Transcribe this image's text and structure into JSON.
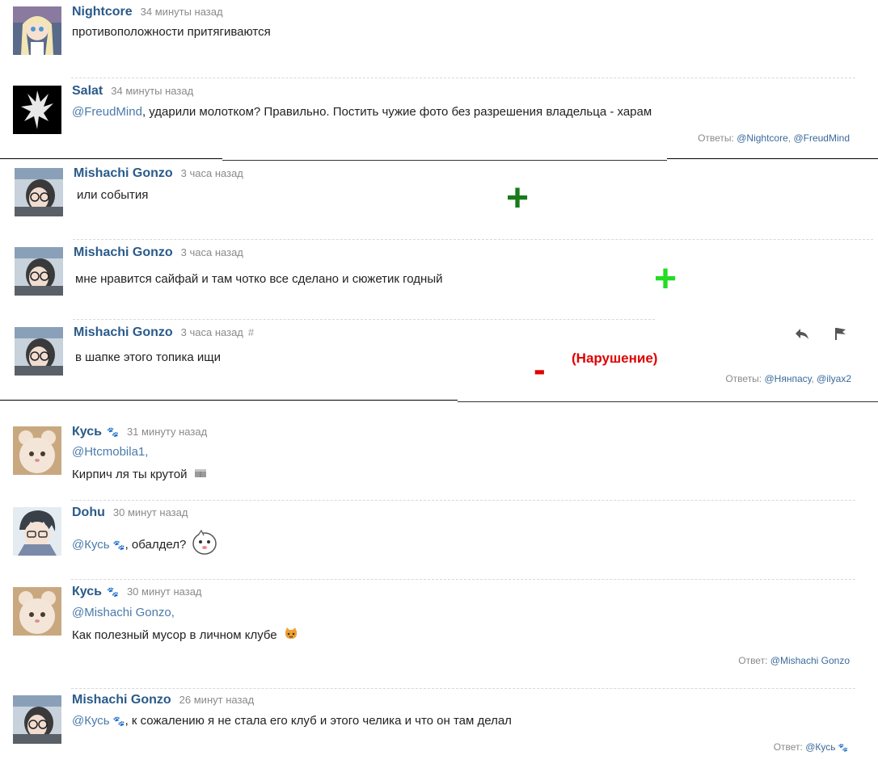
{
  "comments": [
    {
      "author": "Nightcore",
      "time": "34 минуты назад",
      "text": "противоположности притягиваются"
    },
    {
      "author": "Salat",
      "time": "34 минуты назад",
      "mention": "@FreudMind",
      "text": ", ударили молотком? Правильно. Постить чужие фото без разрешения владельца - харам",
      "replies_label": "Ответы:",
      "replies": [
        "@Nightcore",
        "@FreudMind"
      ]
    },
    {
      "author": "Mishachi Gonzo",
      "time": "3 часа назад",
      "text": "или события"
    },
    {
      "author": "Mishachi Gonzo",
      "time": "3 часа назад",
      "text": "мне нравится сайфай и там чотко все сделано и сюжетик годный"
    },
    {
      "author": "Mishachi Gonzo",
      "time": "3 часа назад",
      "hash": "#",
      "text": "в шапке этого топика ищи",
      "replies_label": "Ответы:",
      "replies": [
        "@Нянпасу",
        "@ilyax2"
      ]
    },
    {
      "author": "Кусь",
      "time": "31 минуту назад",
      "mention": "@Htcmobila1,",
      "text": "Кирпич ля ты крутой"
    },
    {
      "author": "Dohu",
      "time": "30 минут назад",
      "mention": "@Кусь",
      "text": ", обалдел?"
    },
    {
      "author": "Кусь",
      "time": "30 минут назад",
      "mention": "@Mishachi Gonzo,",
      "text": "Как полезный мусор в личном клубе",
      "replies_label": "Ответ:",
      "replies": [
        "@Mishachi Gonzo"
      ]
    },
    {
      "author": "Mishachi Gonzo",
      "time": "26 минут назад",
      "mention": "@Кусь",
      "text": ", к сожалению я не стала его клуб и этого челика и что он там делал",
      "replies_label": "Ответ:",
      "replies": [
        "@Кусь"
      ]
    }
  ],
  "annotations": {
    "plus_dark_color": "#1a7a1a",
    "plus_bright_color": "#22dd22",
    "minus_color": "#e00000",
    "violation_label": "(Нарушение)"
  }
}
